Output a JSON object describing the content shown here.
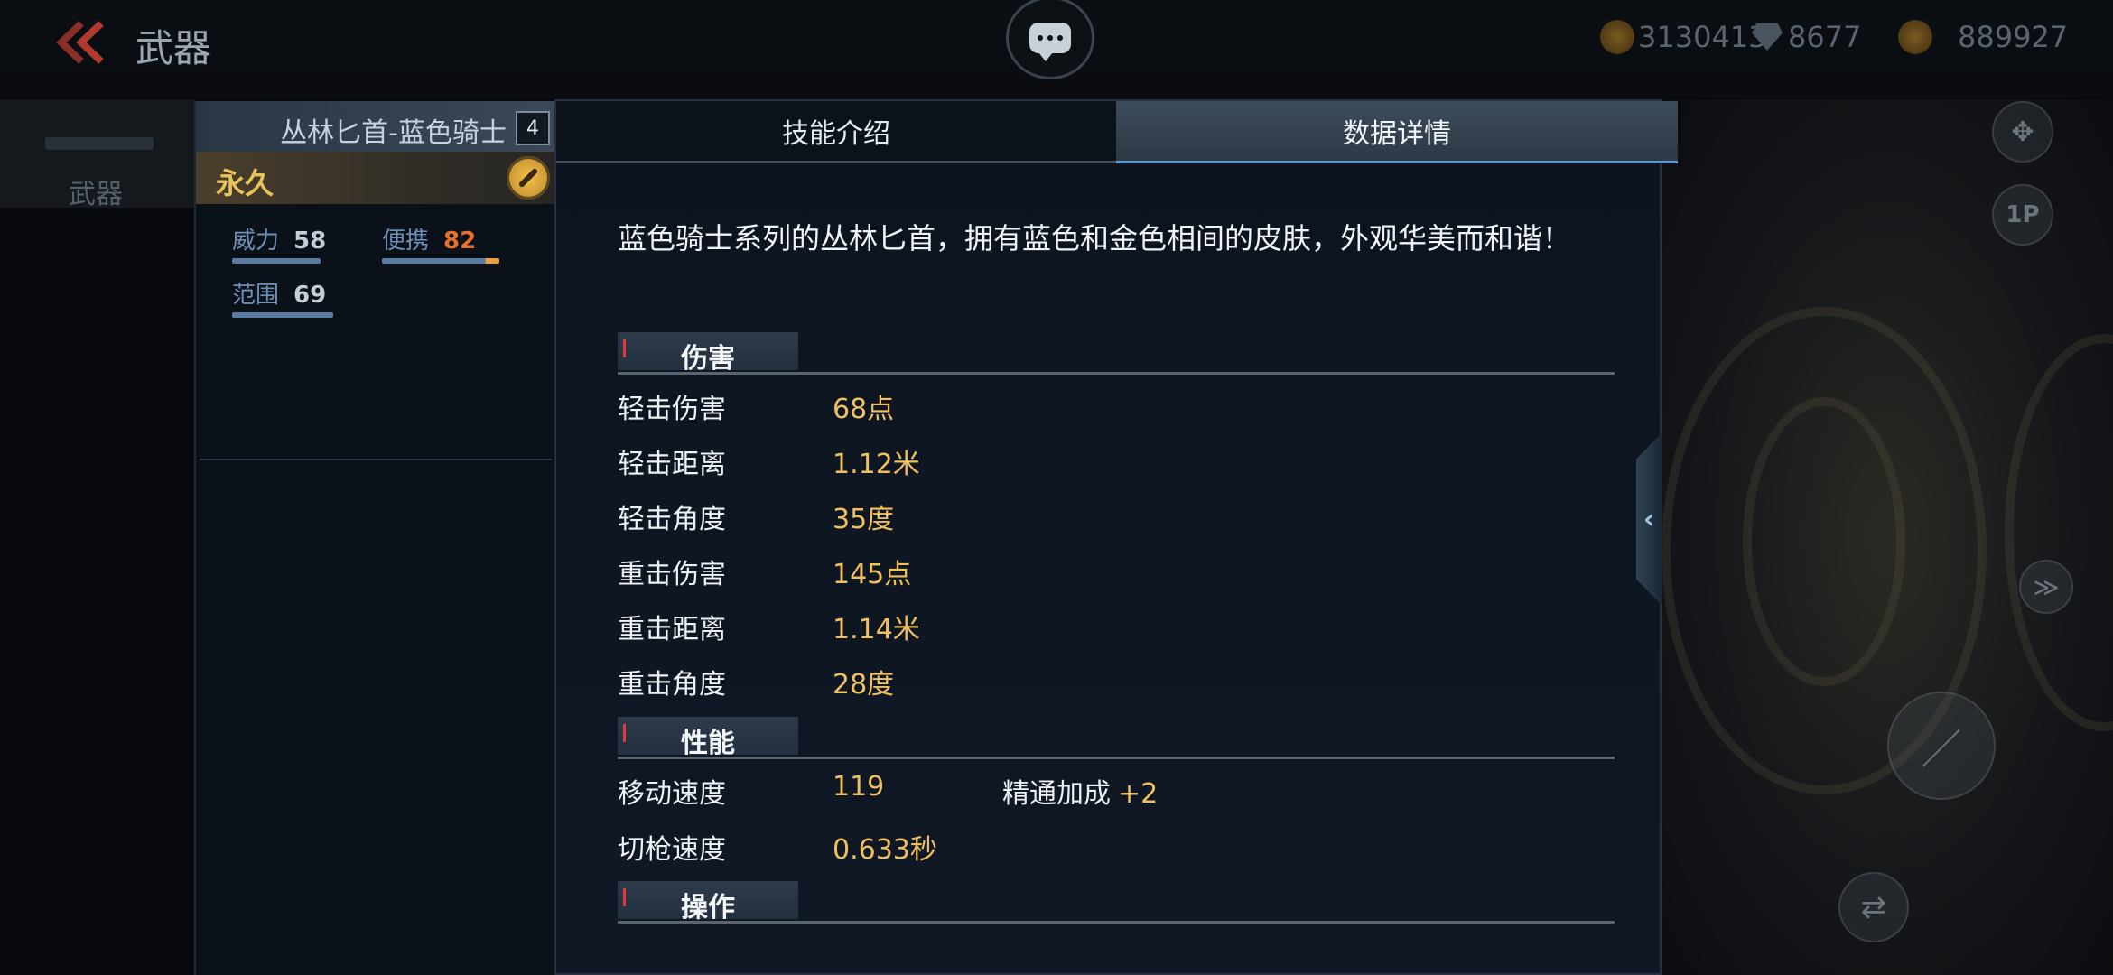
{
  "topbar": {
    "title": "武器",
    "currencies": [
      {
        "icon": "gold-coin-icon",
        "value": "3130413"
      },
      {
        "icon": "diamond-icon",
        "value": "8677"
      },
      {
        "icon": "token-icon",
        "value": "889927"
      }
    ]
  },
  "left_nav": {
    "label": "武器"
  },
  "weapon": {
    "name": "丛林匕首-蓝色骑士",
    "level": "4",
    "duration": "永久",
    "stats": [
      {
        "label": "威力",
        "value": "58",
        "fill": 0.58
      },
      {
        "label": "便携",
        "value": "82",
        "fill": 0.82
      },
      {
        "label": "范围",
        "value": "69",
        "fill": 0.69
      }
    ]
  },
  "tabs": {
    "skill": "技能介绍",
    "data": "数据详情"
  },
  "description": "蓝色骑士系列的丛林匕首，拥有蓝色和金色相间的皮肤，外观华美而和谐！",
  "sections": {
    "damage": {
      "title": "伤害",
      "rows": [
        {
          "label": "轻击伤害",
          "value": "68点"
        },
        {
          "label": "轻击距离",
          "value": "1.12米"
        },
        {
          "label": "轻击角度",
          "value": "35度"
        },
        {
          "label": "重击伤害",
          "value": "145点"
        },
        {
          "label": "重击距离",
          "value": "1.14米"
        },
        {
          "label": "重击角度",
          "value": "28度"
        }
      ]
    },
    "performance": {
      "title": "性能",
      "rows": [
        {
          "label": "移动速度",
          "value": "119"
        },
        {
          "label": "切枪速度",
          "value": "0.633秒"
        }
      ],
      "bonus": {
        "label": "精通加成",
        "value": "+2"
      }
    },
    "operation": {
      "title": "操作"
    }
  },
  "right_controls": {
    "view_mode": "1P"
  },
  "colors": {
    "accent_gold": "#f0c060",
    "portable_stat": "#e8702a",
    "tab_active_underline": "#5a9ad6"
  }
}
